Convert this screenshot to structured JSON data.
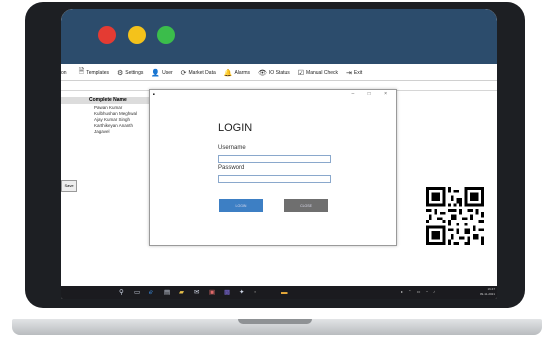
{
  "mac_window": {
    "traffic_lights": {
      "red": "#e43b33",
      "yellow": "#f4c21b",
      "green": "#3bbd4b"
    },
    "header_color": "#2c4c6c"
  },
  "menu": {
    "first_fragment": "on",
    "items": [
      {
        "icon": "templates-icon",
        "label": "Templates"
      },
      {
        "icon": "settings-icon",
        "label": "Settings"
      },
      {
        "icon": "user-icon",
        "label": "User"
      },
      {
        "icon": "market-data-icon",
        "label": "Market Data"
      },
      {
        "icon": "alarms-icon",
        "label": "Alarms"
      },
      {
        "icon": "io-status-icon",
        "label": "IO Status"
      },
      {
        "icon": "manual-check-icon",
        "label": "Manual Check"
      },
      {
        "icon": "exit-icon",
        "label": "Exit"
      }
    ]
  },
  "names_list": {
    "header": "Complete Name",
    "items": [
      "Pawan Kumar",
      "Kulbhushan Meghwal",
      "Ajay Kumar Singh",
      "Karthikeyan Ananth",
      "Jagavel"
    ]
  },
  "side_button": "Save",
  "login_dialog": {
    "heading": "LOGIN",
    "window_controls": "– □ ×",
    "username_label": "Username",
    "username_value": "",
    "password_label": "Password",
    "password_value": "",
    "login_button": "LOGIN",
    "close_button": "CLOSE"
  },
  "taskbar": {
    "time": "16:47",
    "date": "09-11-2021",
    "apps": [
      "search-icon",
      "task-view-icon",
      "edge-icon",
      "store-icon",
      "explorer-icon",
      "mail-icon",
      "media-icon",
      "teams-icon",
      "app-icon",
      "settings-icon",
      "notes-icon"
    ]
  }
}
